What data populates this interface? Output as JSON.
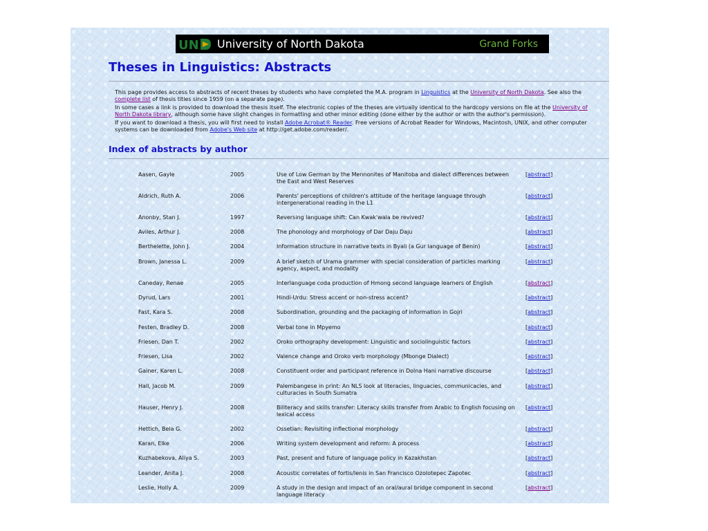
{
  "banner": {
    "university": "University of North Dakota",
    "campus": "Grand Forks",
    "colors": {
      "logo_green": "#1f7a34",
      "logo_gold": "#e0a100",
      "campus_text": "#6cb33f"
    }
  },
  "page": {
    "title": "Theses in Linguistics: Abstracts",
    "index_heading": "Index of abstracts by author"
  },
  "intro": {
    "p1_a": "This page provides access to abstracts of recent theses by students who have completed the M.A. program in ",
    "p1_link1": "Linguistics",
    "p1_b": " at the ",
    "p1_link2": "University of North Dakota",
    "p1_c": ". See also the ",
    "p1_link3": "complete list",
    "p1_d": " of thesis titles since 1959 (on a separate page).",
    "p2_a": "In some cases a link is provided to download the thesis itself. The electronic copies of the theses are virtually identical to the hardcopy versions on file at the ",
    "p2_link1": "University of North Dakota library",
    "p2_b": ", although some have slight changes in formatting and other minor editing (done either by the author or with the author's permission).",
    "p3_a": "If you want to download a thesis, you will first need to install ",
    "p3_link1": "Adobe Acrobat® Reader",
    "p3_b": ". Free versions of Acrobat Reader for Windows, Macintosh, UNIX, and other computer systems can be downloaded from ",
    "p3_link2": "Adobe's Web site",
    "p3_c": " at http://get.adobe.com/reader/."
  },
  "theses": [
    {
      "author": "Aasen, Gayle",
      "year": "2005",
      "title": "Use of Low German by the Mennonites of Manitoba and dialect differences between the East and West Reserves",
      "link": "abstract",
      "visited": false
    },
    {
      "author": "Aldrich, Ruth A.",
      "year": "2006",
      "title": "Parents' perceptions of children's attitude of the heritage language through intergenerational reading in the L1",
      "link": "abstract",
      "visited": false
    },
    {
      "author": "Anonby, Stan J.",
      "year": "1997",
      "title": "Reversing language shift: Can Kwak'wala be revived?",
      "link": "abstract",
      "visited": false
    },
    {
      "author": "Aviles, Arthur J.",
      "year": "2008",
      "title": "The phonology and morphology of Dar Daju Daju",
      "link": "abstract",
      "visited": false
    },
    {
      "author": "Berthelette, John J.",
      "year": "2004",
      "title": "Information structure in narrative texts in Byali (a Gur language of Benin)",
      "link": "abstract",
      "visited": false
    },
    {
      "author": "Brown, Janessa L.",
      "year": "2009",
      "title": "A brief sketch of Urama grammer with special consideration of particles marking agency, aspect, and modality",
      "link": "abstract",
      "visited": false
    },
    {
      "author": "Caneday, Renae",
      "year": "2005",
      "title": "Interlanguage coda production of Hmong second language learners of English",
      "link": "abstract",
      "visited": true
    },
    {
      "author": "Dyrud, Lars",
      "year": "2001",
      "title": "Hindi-Urdu: Stress accent or non-stress accent?",
      "link": "abstract",
      "visited": false
    },
    {
      "author": "Fast, Kara S.",
      "year": "2008",
      "title": "Subordination, grounding and the packaging of information in Gojri",
      "link": "abstract",
      "visited": false
    },
    {
      "author": "Festen, Bradley D.",
      "year": "2008",
      "title": "Verbal tone in Mpyemo",
      "link": "abstract",
      "visited": false
    },
    {
      "author": "Friesen, Dan T.",
      "year": "2002",
      "title": "Oroko orthography development: Linguistic and sociolinguistic factors",
      "link": "abstract",
      "visited": false
    },
    {
      "author": "Friesen, Lisa",
      "year": "2002",
      "title": "Valence change and Oroko verb morphology (Mbonge Dialect)",
      "link": "abstract",
      "visited": false
    },
    {
      "author": "Gainer, Karen L.",
      "year": "2008",
      "title": "Constituent order and participant reference in Dolna Hani narrative discourse",
      "link": "abstract",
      "visited": false
    },
    {
      "author": "Hall, Jacob M.",
      "year": "2009",
      "title": "Palembangese in print: An NLS look at literacies, linguacies, communicacies, and culturacies in South Sumatra",
      "link": "abstract",
      "visited": false
    },
    {
      "author": "Hauser, Henry J.",
      "year": "2008",
      "title": "Biliteracy and skills transfer: Literacy skills transfer from Arabic to English focusing on lexical access",
      "link": "abstract",
      "visited": false
    },
    {
      "author": "Hettich, Bela G.",
      "year": "2002",
      "title": "Ossetian: Revisiting inflectional morphology",
      "link": "abstract",
      "visited": false
    },
    {
      "author": "Karan, Elke",
      "year": "2006",
      "title": "Writing system development and reform: A process",
      "link": "abstract",
      "visited": false
    },
    {
      "author": "Kuzhabekova, Aliya S.",
      "year": "2003",
      "title": "Past, present and future of language policy in Kazakhstan",
      "link": "abstract",
      "visited": false
    },
    {
      "author": "Leander, Anita J.",
      "year": "2008",
      "title": "Acoustic correlates of fortis/lenis in San Francisco Ozolotepec Zapotec",
      "link": "abstract",
      "visited": false
    },
    {
      "author": "Leslie, Holly A.",
      "year": "2009",
      "title": "A study in the design and impact of an oral/aural bridge component in second language literacy",
      "link": "abstract",
      "visited": true
    }
  ]
}
